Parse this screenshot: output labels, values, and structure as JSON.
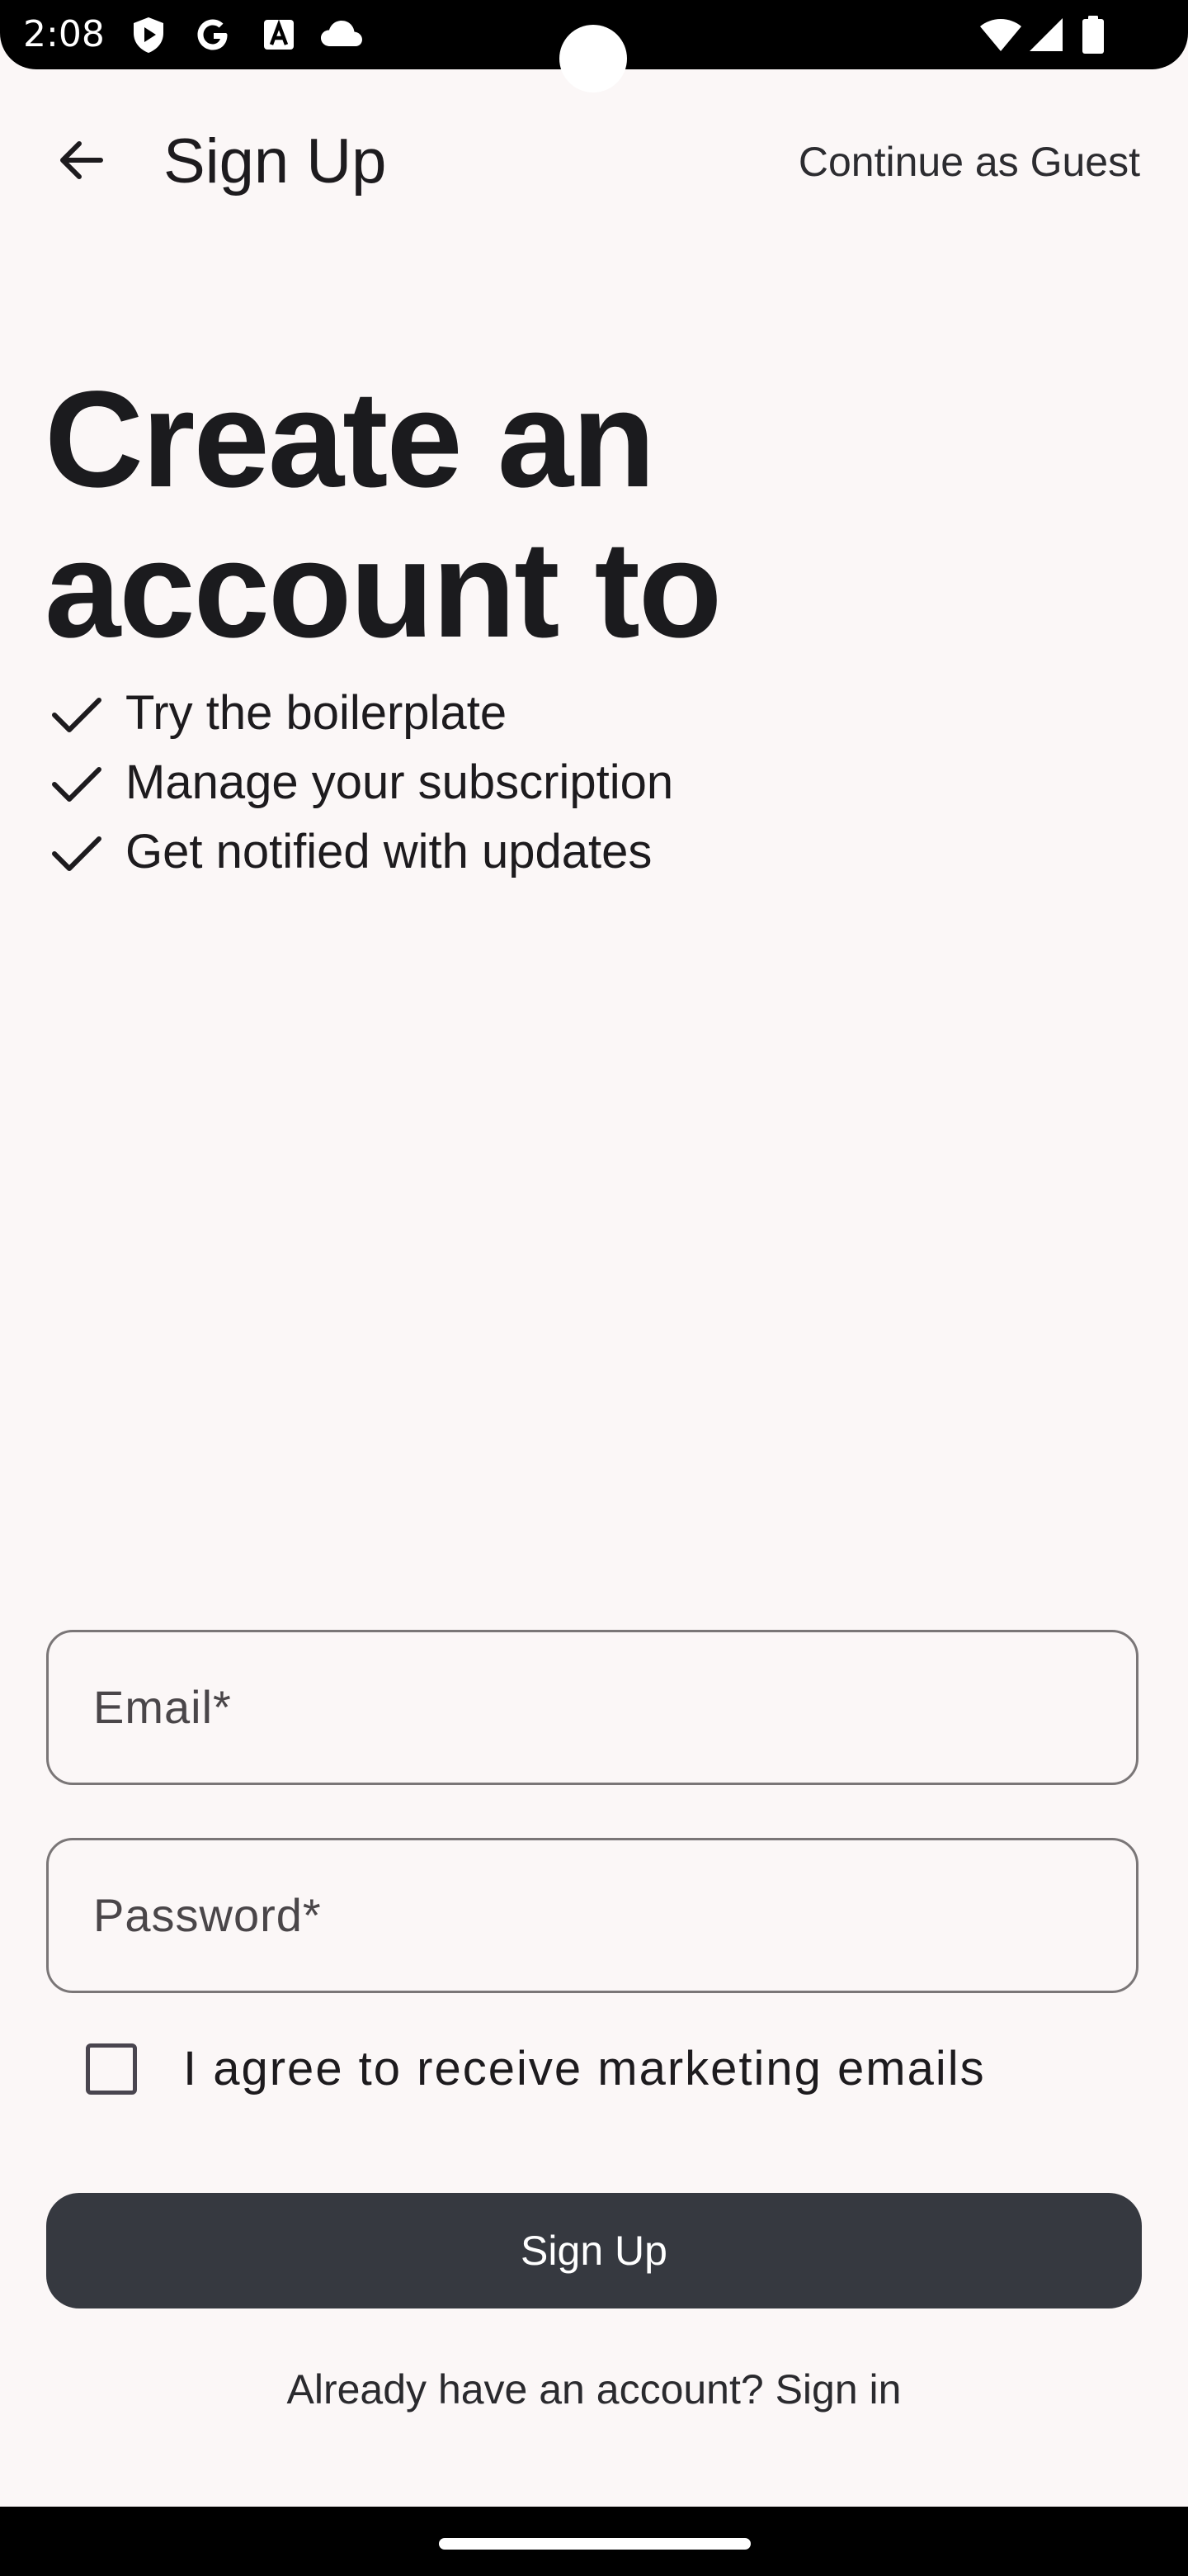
{
  "status_bar": {
    "time": "2:08",
    "icons": [
      "play-shield-icon",
      "google-g-icon",
      "a-box-icon",
      "cloud-icon",
      "wifi-icon",
      "signal-icon",
      "battery-icon"
    ]
  },
  "app_bar": {
    "back_icon": "arrow-left-icon",
    "title": "Sign Up",
    "guest_label": "Continue as Guest"
  },
  "hero": {
    "heading_line1": "Create an",
    "heading_line2": "account to",
    "benefits": [
      {
        "icon": "check-icon",
        "text": "Try the boilerplate"
      },
      {
        "icon": "check-icon",
        "text": "Manage your subscription"
      },
      {
        "icon": "check-icon",
        "text": "Get notified with updates"
      }
    ]
  },
  "form": {
    "email_placeholder": "Email*",
    "password_placeholder": "Password*",
    "marketing_checkbox_label": "I agree to receive marketing emails",
    "marketing_checked": false,
    "submit_label": "Sign Up",
    "signin_prompt": "Already have an account? Sign in"
  },
  "colors": {
    "background": "#fbf7f7",
    "primary_button": "#363940",
    "text": "#1d1b1e",
    "outline": "#7a7677"
  }
}
